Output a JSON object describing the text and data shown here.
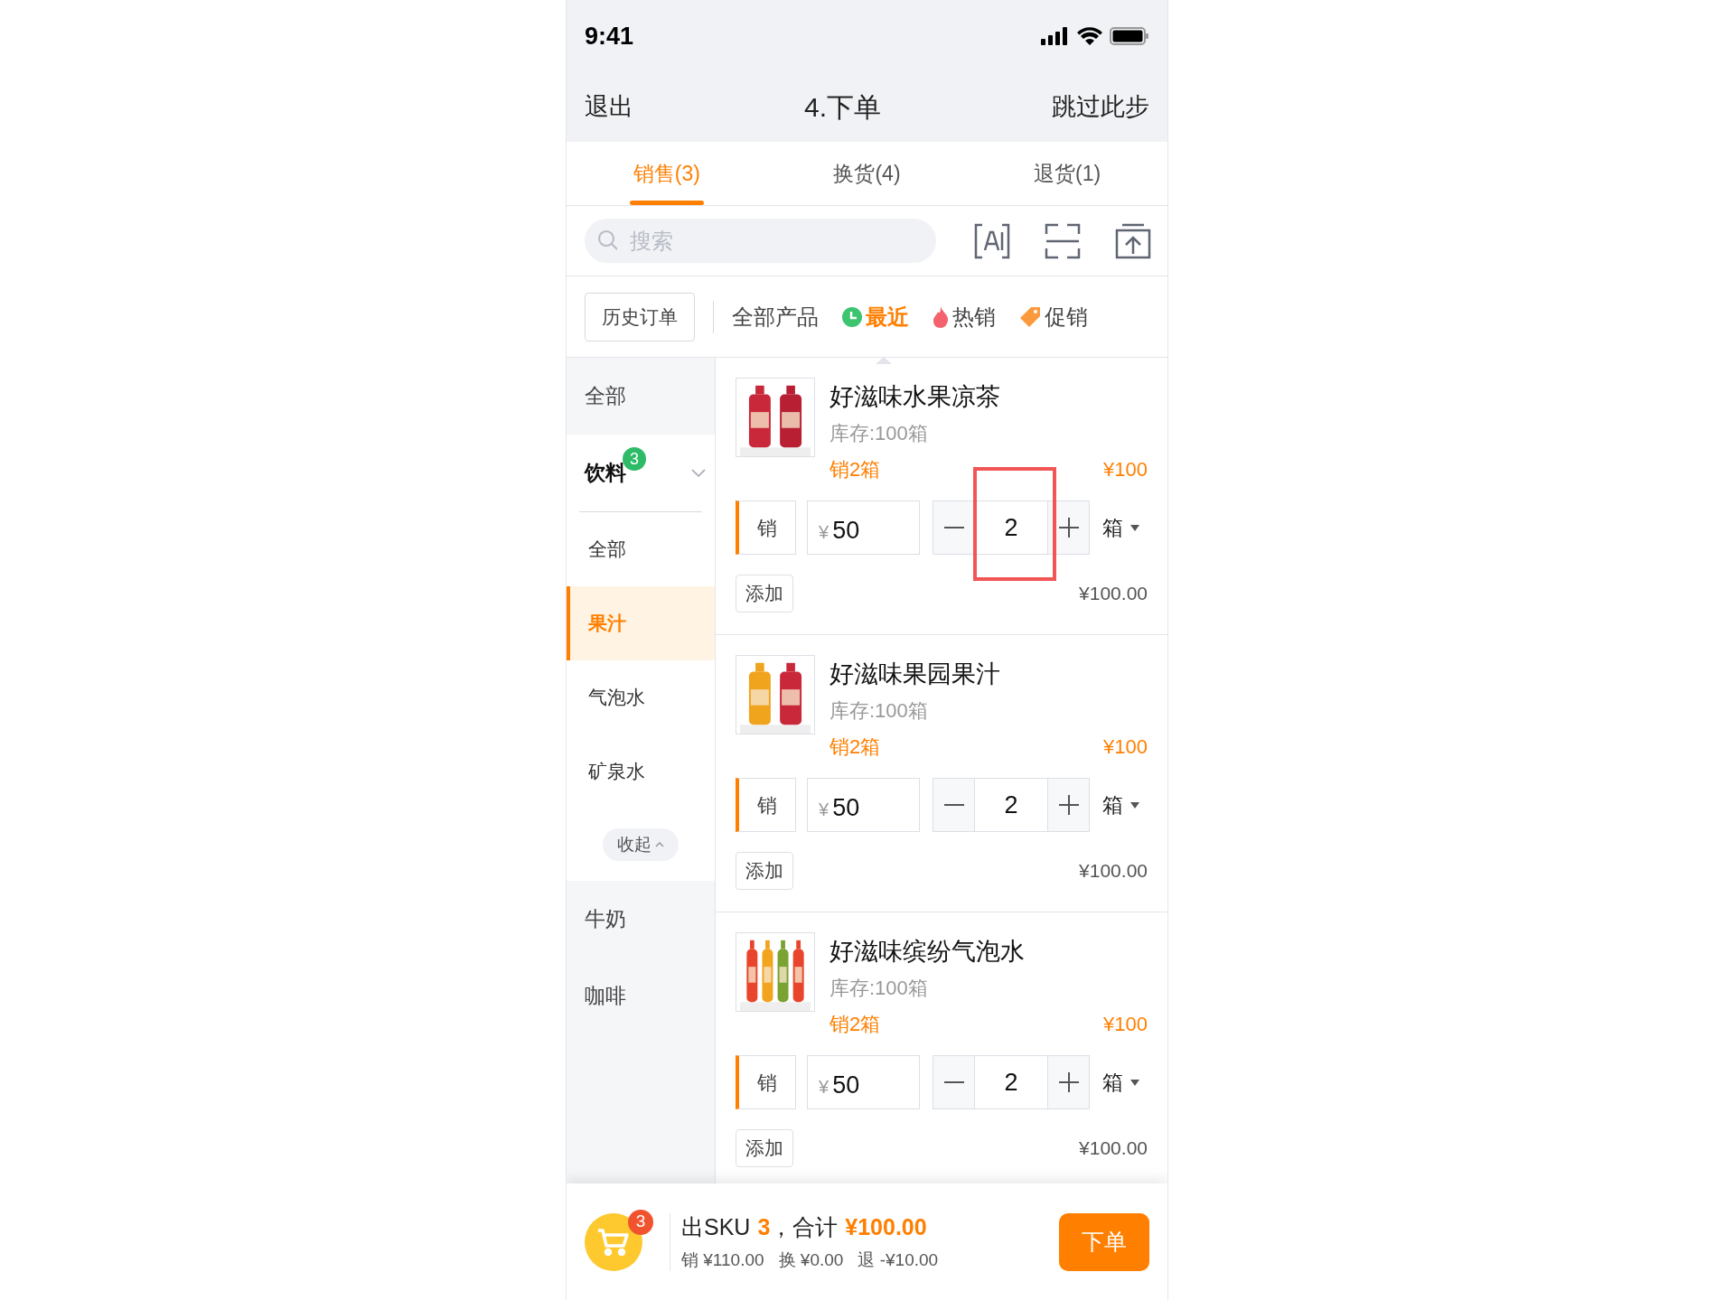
{
  "status_bar": {
    "time": "9:41"
  },
  "header": {
    "left": "退出",
    "title": "4.下单",
    "right": "跳过此步"
  },
  "tabs": [
    {
      "label": "销售(3)",
      "selected": true
    },
    {
      "label": "换货(4)",
      "selected": false
    },
    {
      "label": "退货(1)",
      "selected": false
    }
  ],
  "search": {
    "placeholder": "搜索"
  },
  "history_button": "历史订单",
  "filters": [
    {
      "label": "全部产品",
      "kind": "all",
      "selected": false
    },
    {
      "label": "最近",
      "kind": "recent",
      "selected": true
    },
    {
      "label": "热销",
      "kind": "hot",
      "selected": false
    },
    {
      "label": "促销",
      "kind": "promo",
      "selected": false
    }
  ],
  "sidebar": {
    "items": [
      {
        "label": "全部",
        "selected": false
      },
      {
        "label": "饮料",
        "badge": "3",
        "expanded": true,
        "selected": true,
        "children": [
          {
            "label": "全部",
            "selected": false
          },
          {
            "label": "果汁",
            "selected": true
          },
          {
            "label": "气泡水",
            "selected": false
          },
          {
            "label": "矿泉水",
            "selected": false
          }
        ],
        "collapse": "收起"
      },
      {
        "label": "牛奶",
        "selected": false
      },
      {
        "label": "咖啡",
        "selected": false
      }
    ]
  },
  "products": [
    {
      "name": "好滋味水果凉茶",
      "stock": "库存:100箱",
      "sold": "销2箱",
      "price": "¥100",
      "mode": "销",
      "currency": "¥",
      "unit_price": "50",
      "qty": "2",
      "unit": "箱",
      "add": "添加",
      "subtotal": "¥100.00",
      "highlighted": true
    },
    {
      "name": "好滋味果园果汁",
      "stock": "库存:100箱",
      "sold": "销2箱",
      "price": "¥100",
      "mode": "销",
      "currency": "¥",
      "unit_price": "50",
      "qty": "2",
      "unit": "箱",
      "add": "添加",
      "subtotal": "¥100.00",
      "highlighted": false
    },
    {
      "name": "好滋味缤纷气泡水",
      "stock": "库存:100箱",
      "sold": "销2箱",
      "price": "¥100",
      "mode": "销",
      "currency": "¥",
      "unit_price": "50",
      "qty": "2",
      "unit": "箱",
      "add": "添加",
      "subtotal": "¥100.00",
      "highlighted": false
    }
  ],
  "footer": {
    "cart_badge": "3",
    "sku_label": "出SKU",
    "sku_count": "3",
    "total_label": "，合计",
    "total": "¥100.00",
    "breakdown": [
      "销 ¥110.00",
      "换 ¥0.00",
      "退 -¥10.00"
    ],
    "submit": "下单"
  }
}
